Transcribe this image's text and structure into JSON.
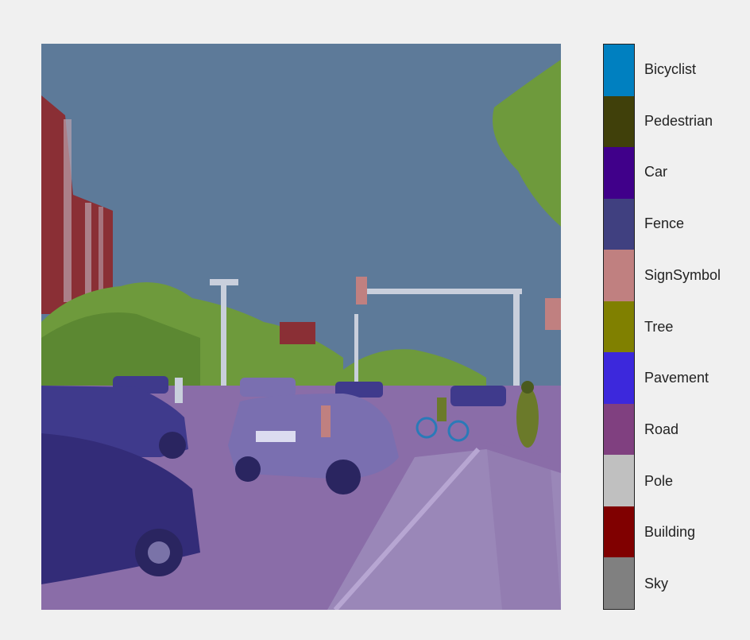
{
  "legend": {
    "classes": [
      {
        "label": "Bicyclist",
        "color": "#0080c0"
      },
      {
        "label": "Pedestrian",
        "color": "#40400a"
      },
      {
        "label": "Car",
        "color": "#40008a"
      },
      {
        "label": "Fence",
        "color": "#404080"
      },
      {
        "label": "SignSymbol",
        "color": "#c08080"
      },
      {
        "label": "Tree",
        "color": "#808000"
      },
      {
        "label": "Pavement",
        "color": "#3c28dc"
      },
      {
        "label": "Road",
        "color": "#804080"
      },
      {
        "label": "Pole",
        "color": "#c0c0c0"
      },
      {
        "label": "Building",
        "color": "#800000"
      },
      {
        "label": "Sky",
        "color": "#808080"
      }
    ]
  },
  "image": {
    "colors": {
      "sky": "#5d7a99",
      "building": "#8a2f35",
      "building_light": "#b9a2ae",
      "tree": "#6e9a3c",
      "tree_dark": "#4f7a2a",
      "road": "#8a6da8",
      "pavement": "#9a87b8",
      "car": "#3f3a8c",
      "car_light": "#7a6fb0",
      "pole": "#c9cfdc",
      "sign": "#c08080",
      "pedestrian": "#6b7a2a",
      "bicyclist": "#2a7ab8"
    }
  }
}
